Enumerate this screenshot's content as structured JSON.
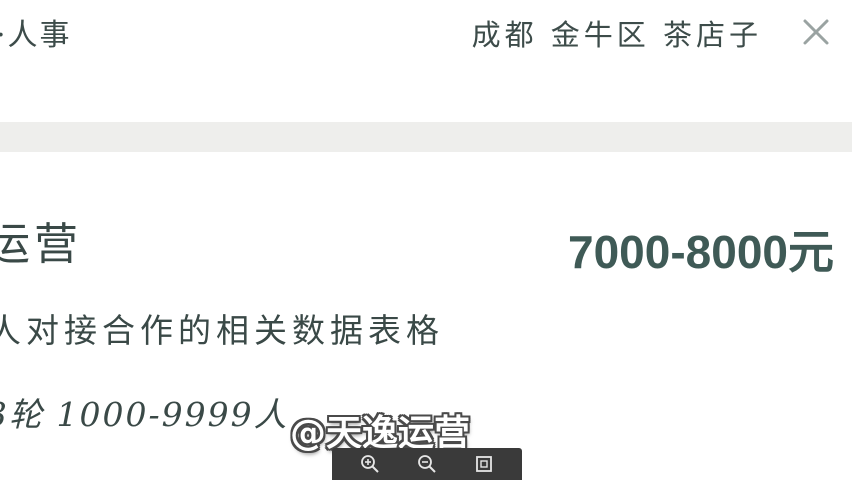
{
  "header": {
    "breadcrumb": "·人事",
    "location": "成都  金牛区  茶店子"
  },
  "card": {
    "job_title": "运营",
    "salary": "7000-8000元",
    "description": "人对接合作的相关数据表格",
    "company_meta": "3轮  1000-9999人"
  },
  "watermark": {
    "text": "@天逸运营"
  },
  "toolbar": {
    "icons": [
      "zoom-in-icon",
      "zoom-out-icon",
      "fit-screen-icon"
    ]
  },
  "colors": {
    "text": "#3a4947",
    "salary": "#3f5a56",
    "band": "#eeeeec",
    "toolbar": "#3a3a3a"
  }
}
